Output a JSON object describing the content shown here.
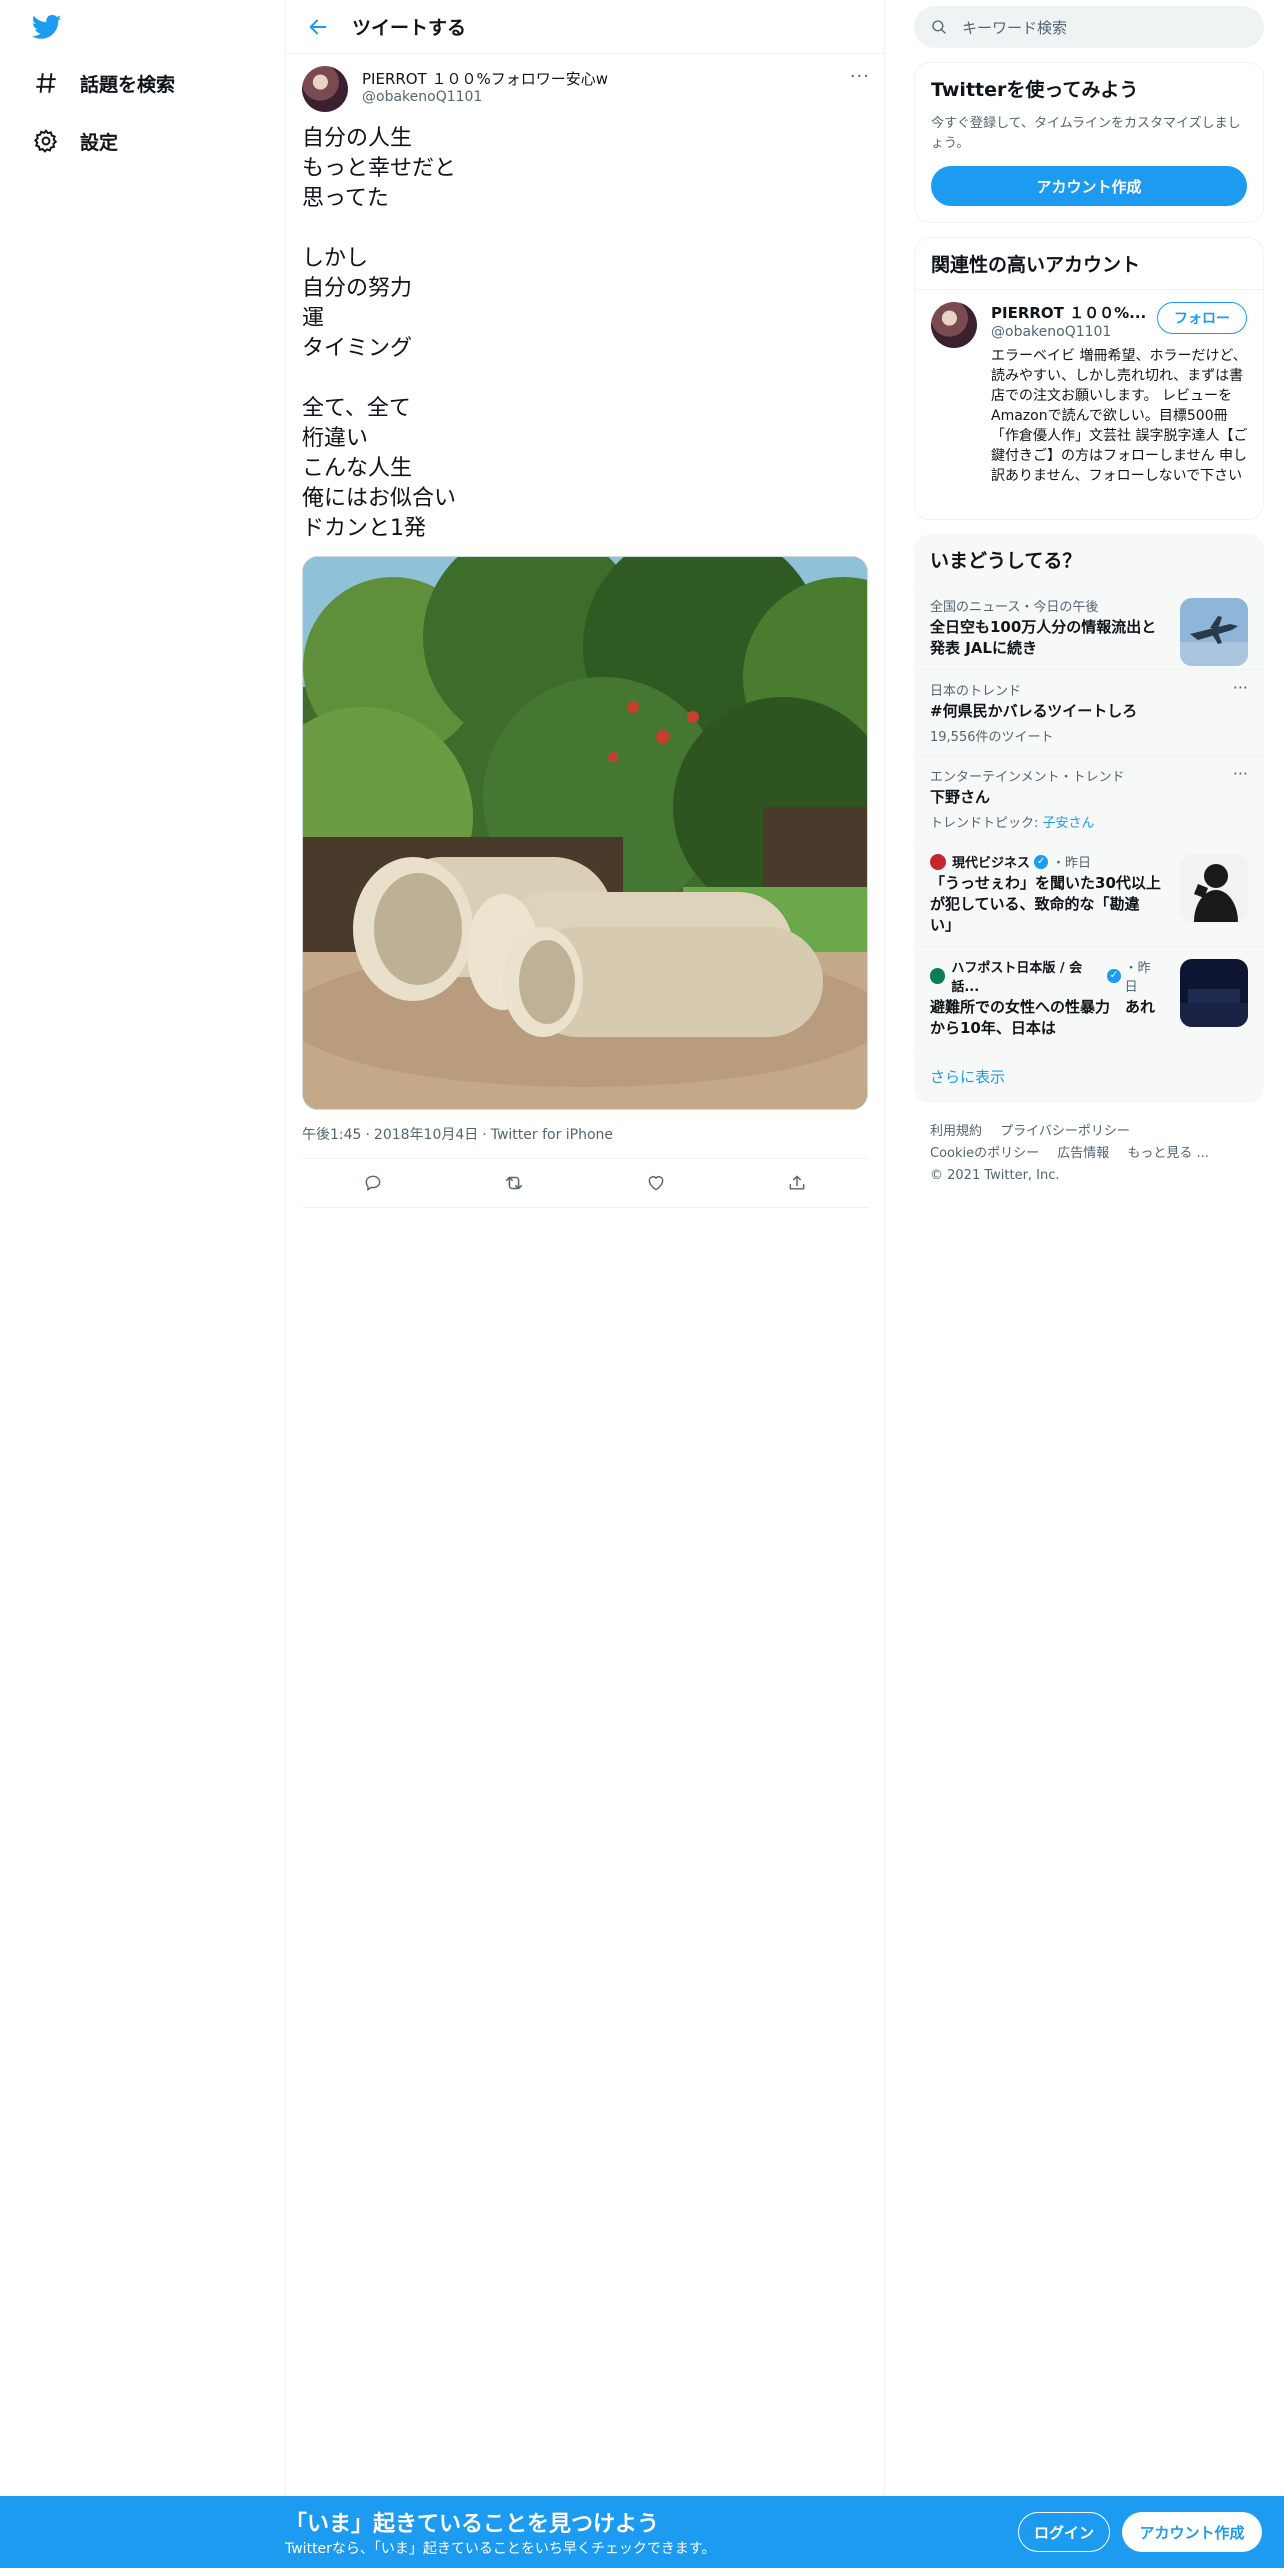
{
  "sidebar": {
    "logo_icon": "twitter-bird-icon",
    "items": [
      {
        "label": "話題を検索",
        "icon": "hashtag-icon"
      },
      {
        "label": "設定",
        "icon": "gear-icon"
      }
    ]
  },
  "header": {
    "title": "ツイートする",
    "back_icon": "arrow-left-icon"
  },
  "tweet": {
    "author_name": "PIERROT １００%フォロワー安心w",
    "author_handle": "@obakenoQ1101",
    "more": "···",
    "paragraphs": [
      [
        "自分の人生",
        "もっと幸せだと",
        "思ってた"
      ],
      [
        "しかし",
        "自分の努力",
        "運",
        "タイミング"
      ],
      [
        "全て、全て",
        "桁違い",
        "こんな人生",
        "俺にはお似合い",
        "ドカンと1発"
      ]
    ],
    "time": "午後1:45",
    "date": "2018年10月4日",
    "client": "Twitter for iPhone",
    "separator": "·"
  },
  "search": {
    "placeholder": "キーワード検索"
  },
  "try_card": {
    "title": "Twitterを使ってみよう",
    "desc": "今すぐ登録して、タイムラインをカスタマイズしましょう。",
    "button": "アカウント作成"
  },
  "related": {
    "title": "関連性の高いアカウント",
    "name": "PIERROT １００%...",
    "handle": "@obakenoQ1101",
    "follow": "フォロー",
    "bio": "エラーベイビ 増冊希望、ホラーだけど、読みやすい、しかし売れ切れ、まずは書店での注文お願いします。 レビューをAmazonで読んで欲しい。目標500冊「作倉優人作」文芸社 誤字脱字達人【ご鍵付きご】の方はフォローしません 申し訳ありません、フォローしないで下さい"
  },
  "trends": {
    "title": "いまどうしてる？",
    "items": [
      {
        "context": "全国のニュース・今日の午後",
        "title": "全日空も100万人分の情報流出と発表 JALに続き"
      },
      {
        "context": "日本のトレンド",
        "title": "#何県民かバレるツイートしろ",
        "sub": "19,556件のツイート"
      },
      {
        "context": "エンターテインメント・トレンド",
        "title": "下野さん",
        "sub_prefix": "トレンドトピック: ",
        "sub_link": "子安さん"
      },
      {
        "source": "現代ビジネス",
        "time": "・昨日",
        "title": "「うっせぇわ」を聞いた30代以上が犯している、致命的な「勘違い」"
      },
      {
        "source": "ハフポスト日本版 / 会話...",
        "time": "・昨日",
        "title": "避難所での女性への性暴力　あれから10年、日本は"
      }
    ],
    "show_more": "さらに表示"
  },
  "footer": {
    "links": [
      "利用規約",
      "プライバシーポリシー",
      "Cookieのポリシー",
      "広告情報",
      "もっと見る ..."
    ],
    "copyright": "© 2021 Twitter, Inc."
  },
  "bottom_bar": {
    "title": "「いま」起きていることを見つけよう",
    "subtitle": "Twitterなら、「いま」起きていることをいち早くチェックできます。",
    "login": "ログイン",
    "signup": "アカウント作成"
  },
  "colors": {
    "accent": "#1d9bf0",
    "text": "#0f1419",
    "muted": "#536471",
    "border": "#eff3f4"
  }
}
